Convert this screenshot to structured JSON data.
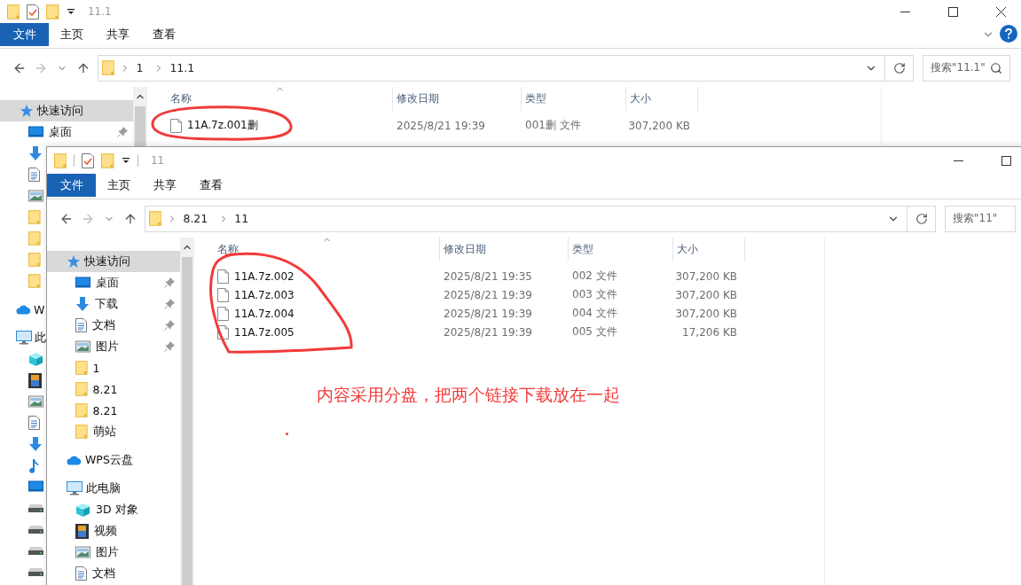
{
  "windows": [
    {
      "title": "11.1",
      "controls": [
        {
          "kind": "minimize"
        },
        {
          "kind": "maximize"
        },
        {
          "kind": "close"
        }
      ],
      "ribbon_tabs": [
        {
          "label": "文件",
          "selected": true
        },
        {
          "label": "主页",
          "selected": false
        },
        {
          "label": "共享",
          "selected": false
        },
        {
          "label": "查看",
          "selected": false
        }
      ],
      "ribbon_help": true,
      "path": [
        "1",
        "11.1"
      ],
      "search": {
        "placeholder": "搜索\"11.1\""
      },
      "nav": [
        {
          "label": "快速访问",
          "kind": "quick",
          "selected": true,
          "children": [
            {
              "label": "桌面",
              "kind": "desktop",
              "pinned": true,
              "selected": false
            },
            {
              "kind": "download",
              "pinned": false,
              "selected": false
            },
            {
              "kind": "document",
              "pinned": false,
              "selected": false
            },
            {
              "kind": "picture",
              "pinned": false,
              "selected": false
            },
            {
              "kind": "folder",
              "pinned": false,
              "selected": false
            },
            {
              "kind": "folder",
              "pinned": false,
              "selected": false
            },
            {
              "kind": "folder",
              "pinned": false,
              "selected": false
            },
            {
              "kind": "folder",
              "pinned": false,
              "selected": false
            }
          ]
        },
        {
          "label": "W",
          "kind": "cloud",
          "selected": false
        },
        {
          "label": "此",
          "kind": "pc",
          "selected": false,
          "children": [
            {
              "kind": "cube",
              "selected": false
            },
            {
              "kind": "video",
              "selected": false
            },
            {
              "kind": "picture",
              "selected": false
            },
            {
              "kind": "document",
              "selected": false
            },
            {
              "kind": "download",
              "selected": false
            },
            {
              "kind": "music",
              "selected": false
            },
            {
              "kind": "desktop",
              "selected": false
            },
            {
              "kind": "drive",
              "selected": false
            },
            {
              "kind": "drive",
              "selected": false
            },
            {
              "kind": "drive",
              "selected": false
            },
            {
              "kind": "drive",
              "selected": false
            }
          ]
        }
      ],
      "columns": [
        "名称",
        "修改日期",
        "类型",
        "大小"
      ],
      "files": [
        {
          "name": "11A.7z.001删",
          "modified": "2025/8/21 19:39",
          "type": "001删 文件",
          "size": "307,200 KB"
        }
      ]
    },
    {
      "title": "11",
      "controls": [
        {
          "kind": "minimize"
        },
        {
          "kind": "maximize"
        }
      ],
      "ribbon_tabs": [
        {
          "label": "文件",
          "selected": true
        },
        {
          "label": "主页",
          "selected": false
        },
        {
          "label": "共享",
          "selected": false
        },
        {
          "label": "查看",
          "selected": false
        }
      ],
      "ribbon_help": false,
      "path": [
        "8.21",
        "11"
      ],
      "search": {
        "placeholder": "搜索\"11\""
      },
      "nav": [
        {
          "label": "快速访问",
          "kind": "quick",
          "selected": true,
          "children": [
            {
              "label": "桌面",
              "kind": "desktop",
              "pinned": true,
              "selected": false
            },
            {
              "label": "下载",
              "kind": "download",
              "pinned": true,
              "selected": false
            },
            {
              "label": "文档",
              "kind": "document",
              "pinned": true,
              "selected": false
            },
            {
              "label": "图片",
              "kind": "picture",
              "pinned": true,
              "selected": false
            },
            {
              "label": "1",
              "kind": "folder",
              "pinned": false,
              "selected": false
            },
            {
              "label": "8.21",
              "kind": "folder",
              "pinned": false,
              "selected": false
            },
            {
              "label": "8.21",
              "kind": "folder",
              "pinned": false,
              "selected": false
            },
            {
              "label": "萌站",
              "kind": "folder",
              "pinned": false,
              "selected": false
            }
          ]
        },
        {
          "label": "WPS云盘",
          "kind": "cloud",
          "selected": false
        },
        {
          "label": "此电脑",
          "kind": "pc",
          "selected": false,
          "children": [
            {
              "label": "3D 对象",
              "kind": "cube",
              "selected": false
            },
            {
              "label": "视频",
              "kind": "video",
              "selected": false
            },
            {
              "label": "图片",
              "kind": "picture",
              "selected": false
            },
            {
              "label": "文档",
              "kind": "document",
              "selected": false
            }
          ]
        }
      ],
      "columns": [
        "名称",
        "修改日期",
        "类型",
        "大小"
      ],
      "files": [
        {
          "name": "11A.7z.002",
          "modified": "2025/8/21 19:35",
          "type": "002 文件",
          "size": "307,200 KB"
        },
        {
          "name": "11A.7z.003",
          "modified": "2025/8/21 19:39",
          "type": "003 文件",
          "size": "307,200 KB"
        },
        {
          "name": "11A.7z.004",
          "modified": "2025/8/21 19:39",
          "type": "004 文件",
          "size": "307,200 KB"
        },
        {
          "name": "11A.7z.005",
          "modified": "2025/8/21 19:39",
          "type": "005 文件",
          "size": "17,206 KB"
        }
      ]
    }
  ],
  "annotation": {
    "note": "内容采用分盘，把两个链接下载放在一起"
  }
}
